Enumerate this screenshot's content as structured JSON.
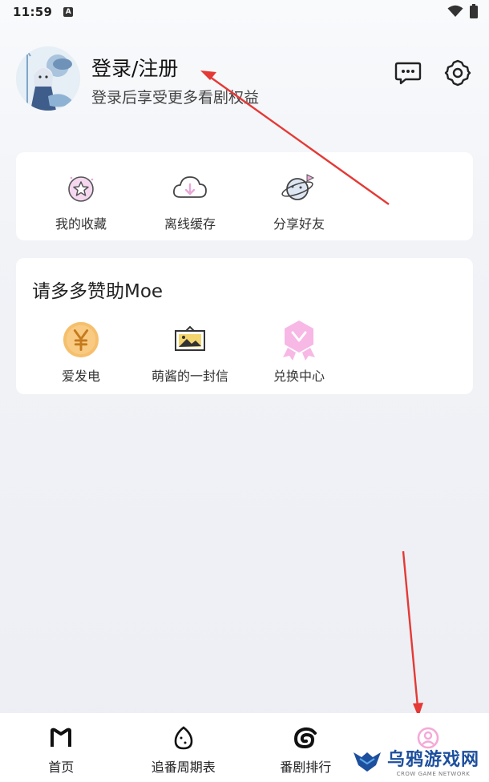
{
  "status_bar": {
    "time": "11:59",
    "badge": "A"
  },
  "profile": {
    "title": "登录/注册",
    "subtitle": "登录后享受更多看剧权益"
  },
  "header_icons": [
    "chat-icon",
    "gear-icon"
  ],
  "quick_actions": [
    {
      "label": "我的收藏",
      "icon": "favorite-star-icon"
    },
    {
      "label": "离线缓存",
      "icon": "cloud-download-icon"
    },
    {
      "label": "分享好友",
      "icon": "share-planet-icon"
    }
  ],
  "support": {
    "title": "请多多赞助Moe",
    "items": [
      {
        "label": "爱发电",
        "icon": "yen-coin-icon"
      },
      {
        "label": "萌酱的一封信",
        "icon": "letter-picture-icon"
      },
      {
        "label": "兑换中心",
        "icon": "exchange-badge-icon"
      }
    ]
  },
  "bottom_nav": [
    {
      "label": "首页",
      "icon": "home-m-icon"
    },
    {
      "label": "追番周期表",
      "icon": "egg-icon"
    },
    {
      "label": "番剧排行",
      "icon": "swirl-icon"
    },
    {
      "label": "",
      "icon": "profile-icon"
    }
  ],
  "watermark": {
    "main": "乌鸦游戏网",
    "sub": "CROW GAME NETWORK"
  },
  "colors": {
    "annotation_arrow": "#e53935",
    "coin": "#f4b560",
    "badge_pink": "#f7b8e6",
    "nav_active": "#f5a9d6"
  }
}
